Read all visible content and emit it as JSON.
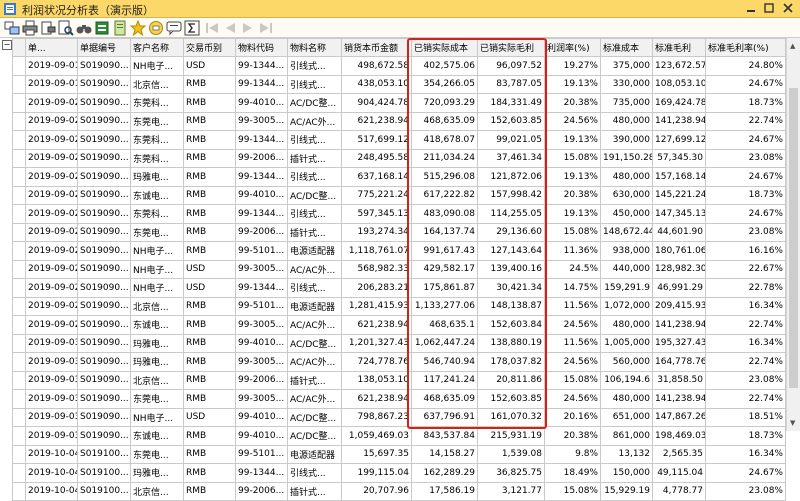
{
  "window": {
    "title": "利润状况分析表（演示版）"
  },
  "toolbar": {
    "icons": [
      "grid-icon",
      "print-icon",
      "print-setup-icon",
      "find-icon",
      "binoculars-icon",
      "export-excel-icon",
      "favorite-star-icon",
      "message-icon",
      "chat-icon",
      "sigma-icon",
      "nav-first-icon",
      "nav-prev-icon",
      "nav-next-icon",
      "nav-last-icon"
    ]
  },
  "table": {
    "columns": [
      "单...",
      "单据编号",
      "客户名称",
      "交易币别",
      "物料代码",
      "物料名称",
      "销货本币金额",
      "已销实际成本",
      "已销实际毛利",
      "利润率(%)",
      "标准成本",
      "标准毛利",
      "标准毛利率(%)"
    ],
    "rows": [
      [
        "2019-09-01",
        "S019090...",
        "NH电子...",
        "USD",
        "99-1344...",
        "引线式...",
        "498,672.58",
        "402,575.06",
        "96,097.52",
        "19.27%",
        "375,000",
        "123,672.57",
        "24.80%"
      ],
      [
        "2019-09-01",
        "S019090...",
        "北京信...",
        "RMB",
        "99-1344...",
        "引线式...",
        "438,053.10",
        "354,266.05",
        "83,787.05",
        "19.13%",
        "330,000",
        "108,053.10",
        "24.67%"
      ],
      [
        "2019-09-02",
        "S019090...",
        "东莞科...",
        "RMB",
        "99-4010...",
        "AC/DC整...",
        "904,424.78",
        "720,093.29",
        "184,331.49",
        "20.38%",
        "735,000",
        "169,424.78",
        "18.73%"
      ],
      [
        "2019-09-02",
        "S019090...",
        "东莞电...",
        "RMB",
        "99-3005...",
        "AC/AC外...",
        "621,238.94",
        "468,635.09",
        "152,603.85",
        "24.56%",
        "480,000",
        "141,238.94",
        "22.74%"
      ],
      [
        "2019-09-02",
        "S019090...",
        "东莞科...",
        "RMB",
        "99-1344...",
        "引线式...",
        "517,699.12",
        "418,678.07",
        "99,021.05",
        "19.13%",
        "390,000",
        "127,699.12",
        "24.67%"
      ],
      [
        "2019-09-02",
        "S019090...",
        "东莞科...",
        "RMB",
        "99-2006...",
        "插针式...",
        "248,495.58",
        "211,034.24",
        "37,461.34",
        "15.08%",
        "191,150.28",
        "57,345.30",
        "23.08%"
      ],
      [
        "2019-09-02",
        "S019090...",
        "玛雅电...",
        "RMB",
        "99-1344...",
        "引线式...",
        "637,168.14",
        "515,296.08",
        "121,872.06",
        "19.13%",
        "480,000",
        "157,168.14",
        "24.67%"
      ],
      [
        "2019-09-02",
        "S019090...",
        "东诚电...",
        "RMB",
        "99-4010...",
        "AC/DC整...",
        "775,221.24",
        "617,222.82",
        "157,998.42",
        "20.38%",
        "630,000",
        "145,221.24",
        "18.73%"
      ],
      [
        "2019-09-02",
        "S019090...",
        "东莞科...",
        "RMB",
        "99-1344...",
        "引线式...",
        "597,345.13",
        "483,090.08",
        "114,255.05",
        "19.13%",
        "450,000",
        "147,345.13",
        "24.67%"
      ],
      [
        "2019-09-02",
        "S019090...",
        "东莞电...",
        "RMB",
        "99-2006...",
        "插针式...",
        "193,274.34",
        "164,137.74",
        "29,136.60",
        "15.08%",
        "148,672.44",
        "44,601.90",
        "23.08%"
      ],
      [
        "2019-09-02",
        "S019090...",
        "NH电子...",
        "RMB",
        "99-5101...",
        "电源适配器",
        "1,118,761.07",
        "991,617.43",
        "127,143.64",
        "11.36%",
        "938,000",
        "180,761.06",
        "16.16%"
      ],
      [
        "2019-09-02",
        "S019090...",
        "NH电子...",
        "USD",
        "99-3005...",
        "AC/AC外...",
        "568,982.33",
        "429,582.17",
        "139,400.16",
        "24.5%",
        "440,000",
        "128,982.30",
        "22.67%"
      ],
      [
        "2019-09-02",
        "S019090...",
        "NH电子...",
        "USD",
        "99-1344...",
        "引线式...",
        "206,283.21",
        "175,861.87",
        "30,421.34",
        "14.75%",
        "159,291.9",
        "46,991.29",
        "22.78%"
      ],
      [
        "2019-09-02",
        "S019090...",
        "北京信...",
        "RMB",
        "99-5101...",
        "电源适配器",
        "1,281,415.93",
        "1,133,277.06",
        "148,138.87",
        "11.56%",
        "1,072,000",
        "209,415.93",
        "16.34%"
      ],
      [
        "2019-09-02",
        "S019090...",
        "东诚电...",
        "RMB",
        "99-3005...",
        "AC/AC外...",
        "621,238.94",
        "468,635.1",
        "152,603.84",
        "24.56%",
        "480,000",
        "141,238.94",
        "22.74%"
      ],
      [
        "2019-09-03",
        "S019090...",
        "玛雅电...",
        "RMB",
        "99-4010...",
        "AC/DC整...",
        "1,201,327.43",
        "1,062,447.24",
        "138,880.19",
        "11.56%",
        "1,005,000",
        "195,327.43",
        "16.34%"
      ],
      [
        "2019-09-03",
        "S019090...",
        "玛雅电...",
        "RMB",
        "99-3005...",
        "AC/AC外...",
        "724,778.76",
        "546,740.94",
        "178,037.82",
        "24.56%",
        "560,000",
        "164,778.76",
        "22.74%"
      ],
      [
        "2019-09-03",
        "S019090...",
        "北京信...",
        "RMB",
        "99-2006...",
        "插针式...",
        "138,053.10",
        "117,241.24",
        "20,811.86",
        "15.08%",
        "106,194.6",
        "31,858.50",
        "23.08%"
      ],
      [
        "2019-09-03",
        "S019090...",
        "东莞电...",
        "RMB",
        "99-3005...",
        "AC/AC外...",
        "621,238.94",
        "468,635.09",
        "152,603.85",
        "24.56%",
        "480,000",
        "141,238.94",
        "22.74%"
      ],
      [
        "2019-09-03",
        "S019090...",
        "NH电子...",
        "USD",
        "99-4010...",
        "AC/DC整...",
        "798,867.23",
        "637,796.91",
        "161,070.32",
        "20.16%",
        "651,000",
        "147,867.26",
        "18.51%"
      ],
      [
        "2019-09-03",
        "S019090...",
        "东诚电...",
        "RMB",
        "99-4010...",
        "AC/DC整...",
        "1,059,469.03",
        "843,537.84",
        "215,931.19",
        "20.38%",
        "861,000",
        "198,469.03",
        "18.73%"
      ],
      [
        "2019-10-04",
        "S019100...",
        "东莞电...",
        "RMB",
        "99-5101...",
        "电源适配器",
        "15,697.35",
        "14,158.27",
        "1,539.08",
        "9.8%",
        "13,132",
        "2,565.35",
        "16.34%"
      ],
      [
        "2019-10-04",
        "S019100...",
        "玛雅电...",
        "RMB",
        "99-1344...",
        "引线式...",
        "199,115.04",
        "162,289.29",
        "36,825.75",
        "18.49%",
        "150,000",
        "49,115.04",
        "24.67%"
      ],
      [
        "2019-10-04",
        "S019100...",
        "北京信...",
        "RMB",
        "99-2006...",
        "插针式...",
        "20,707.96",
        "17,586.19",
        "3,121.77",
        "15.08%",
        "15,929.19",
        "4,778.77",
        "23.08%"
      ]
    ]
  }
}
